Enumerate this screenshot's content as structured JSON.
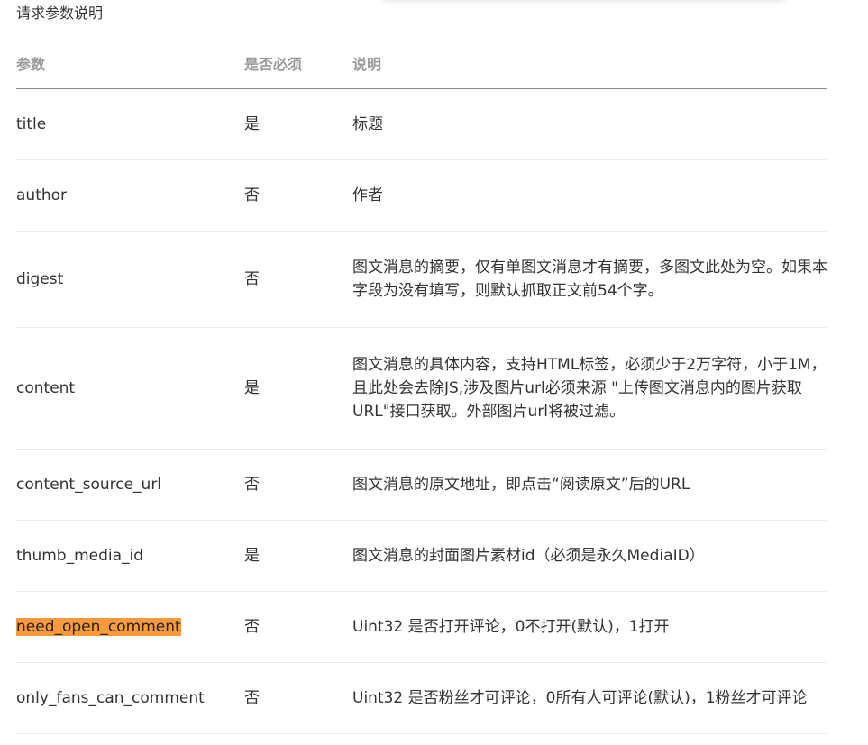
{
  "section_title": "请求参数说明",
  "colors": {
    "highlight": "#ff9a3c",
    "header_text": "#999999"
  },
  "table": {
    "headers": [
      "参数",
      "是否必须",
      "说明"
    ],
    "rows": [
      {
        "param": "title",
        "required": "是",
        "desc": "标题"
      },
      {
        "param": "author",
        "required": "否",
        "desc": "作者"
      },
      {
        "param": "digest",
        "required": "否",
        "desc": "图文消息的摘要，仅有单图文消息才有摘要，多图文此处为空。如果本字段为没有填写，则默认抓取正文前54个字。"
      },
      {
        "param": "content",
        "required": "是",
        "desc": "图文消息的具体内容，支持HTML标签，必须少于2万字符，小于1M，且此处会去除JS,涉及图片url必须来源 \"上传图文消息内的图片获取URL\"接口获取。外部图片url将被过滤。"
      },
      {
        "param": "content_source_url",
        "required": "否",
        "desc": "图文消息的原文地址，即点击“阅读原文”后的URL"
      },
      {
        "param": "thumb_media_id",
        "required": "是",
        "desc": "图文消息的封面图片素材id（必须是永久MediaID）"
      },
      {
        "param": "need_open_comment",
        "required": "否",
        "desc": "Uint32 是否打开评论，0不打开(默认)，1打开"
      },
      {
        "param": "only_fans_can_comment",
        "required": "否",
        "desc": "Uint32 是否粉丝才可评论，0所有人可评论(默认)，1粉丝才可评论"
      }
    ]
  }
}
